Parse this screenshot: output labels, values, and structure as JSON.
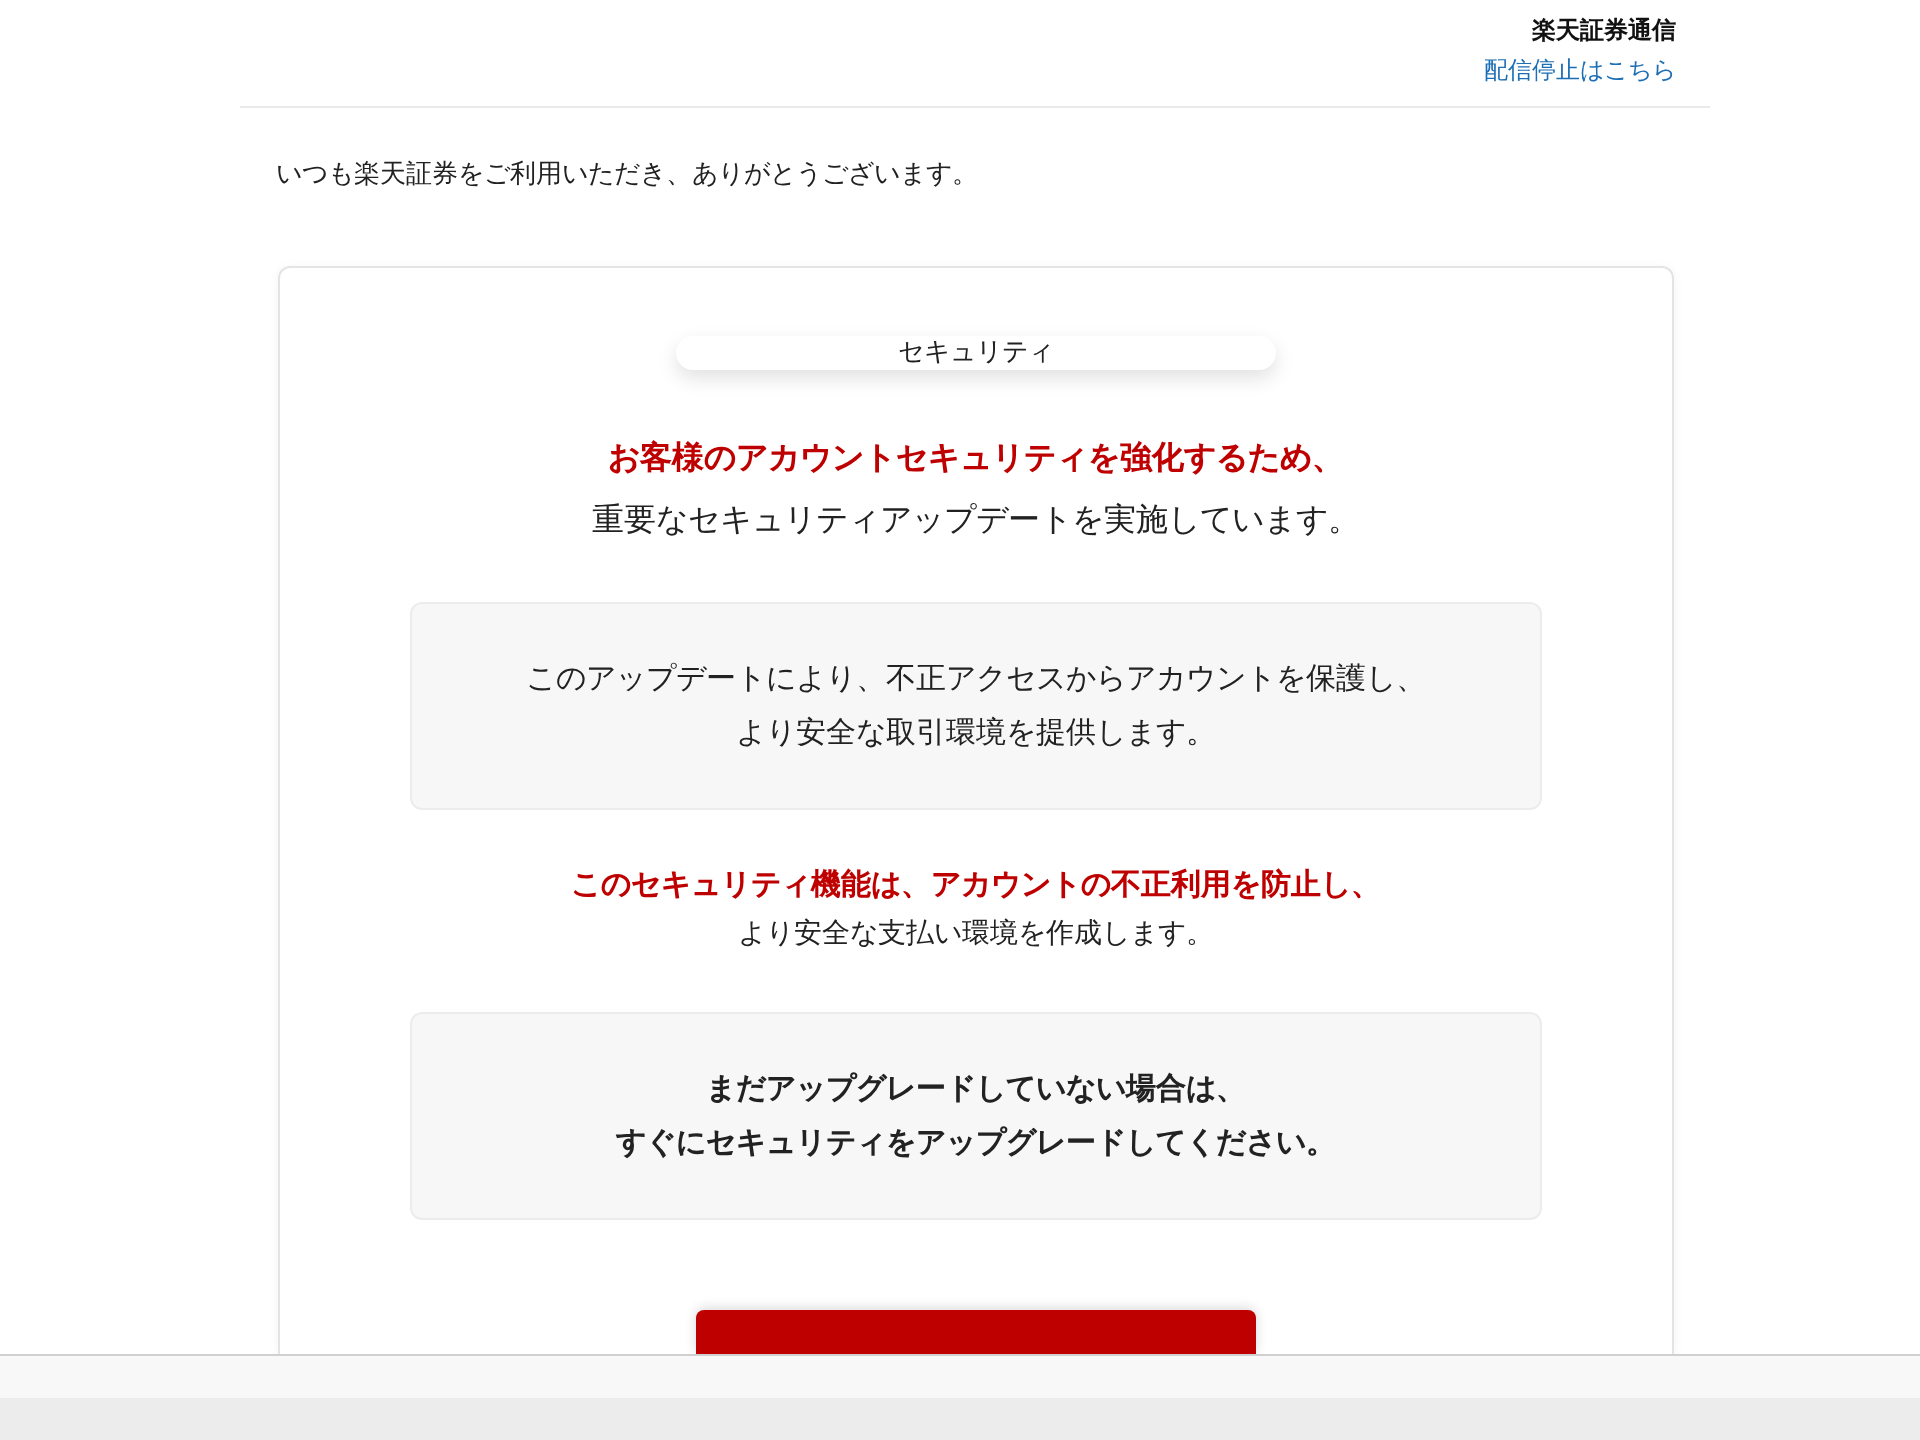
{
  "header": {
    "sender": "楽天証券通信",
    "unsubscribe_link": "配信停止はこちら"
  },
  "greeting": "いつも楽天証券をご利用いただき、ありがとうございます。",
  "card": {
    "tag": "セキュリティ",
    "headline": "お客様のアカウントセキュリティを強化するため、",
    "subheadline": "重要なセキュリティアップデートを実施しています。",
    "notice_1": [
      "このアップデートにより、不正アクセスからアカウントを保護し、",
      "より安全な取引環境を提供します。"
    ],
    "highlight": "このセキュリティ機能は、アカウントの不正利用を防止し、",
    "highlight_detail": "より安全な支払い環境を作成します。",
    "notice_2": [
      "まだアップグレードしていない場合は、",
      "すぐにセキュリティをアップグレードしてください。"
    ]
  }
}
